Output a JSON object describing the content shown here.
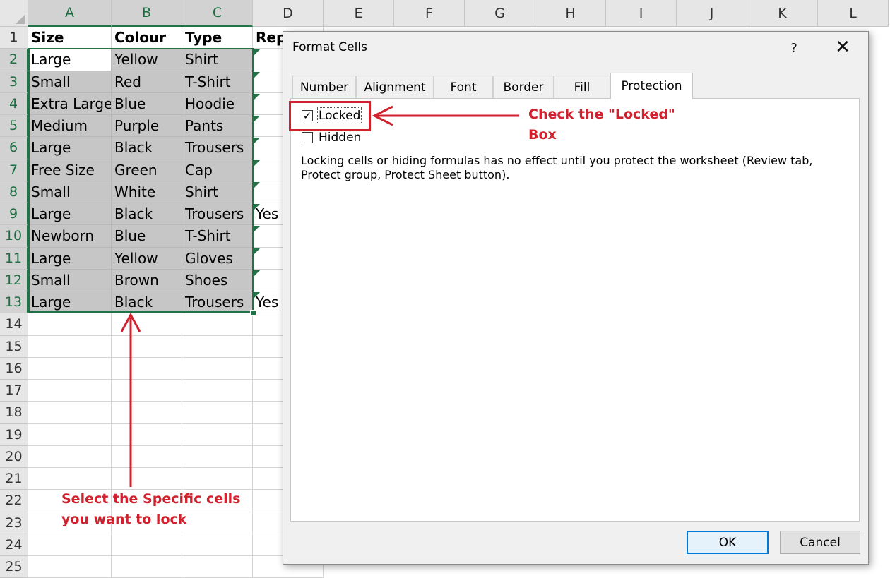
{
  "sheet": {
    "columns": [
      "A",
      "B",
      "C",
      "D",
      "E",
      "F",
      "G",
      "H",
      "I",
      "J",
      "K",
      "L"
    ],
    "row_numbers": [
      "1",
      "2",
      "3",
      "4",
      "5",
      "6",
      "7",
      "8",
      "9",
      "10",
      "11",
      "12",
      "13",
      "14",
      "15",
      "16",
      "17",
      "18",
      "19",
      "20",
      "21",
      "22",
      "23",
      "24",
      "25"
    ],
    "header_row": [
      "Size",
      "Colour",
      "Type",
      "Rep"
    ],
    "rows": [
      [
        "Large",
        "Yellow",
        "Shirt",
        ""
      ],
      [
        "Small",
        "Red",
        "T-Shirt",
        ""
      ],
      [
        "Extra Large",
        "Blue",
        "Hoodie",
        ""
      ],
      [
        "Medium",
        "Purple",
        "Pants",
        ""
      ],
      [
        "Large",
        "Black",
        "Trousers",
        ""
      ],
      [
        "Free Size",
        "Green",
        "Cap",
        ""
      ],
      [
        "Small",
        "White",
        "Shirt",
        ""
      ],
      [
        "Large",
        "Black",
        "Trousers",
        "Yes"
      ],
      [
        "Newborn",
        "Blue",
        "T-Shirt",
        ""
      ],
      [
        "Large",
        "Yellow",
        "Gloves",
        ""
      ],
      [
        "Small",
        "Brown",
        "Shoes",
        ""
      ],
      [
        "Large",
        "Black",
        "Trousers",
        "Yes"
      ]
    ]
  },
  "dialog": {
    "title": "Format Cells",
    "help": "?",
    "close": "✕",
    "tabs": [
      "Number",
      "Alignment",
      "Font",
      "Border",
      "Fill",
      "Protection"
    ],
    "active_tab": "Protection",
    "locked_label": "Locked",
    "locked_checked": true,
    "hidden_label": "Hidden",
    "hidden_checked": false,
    "info_text": "Locking cells or hiding formulas has no effect until you protect the worksheet (Review tab, Protect group, Protect Sheet button).",
    "ok_label": "OK",
    "cancel_label": "Cancel"
  },
  "annotations": {
    "locked_note_line1": "Check the \"Locked\"",
    "locked_note_line2": "Box",
    "select_note_line1": "Select the Specific cells",
    "select_note_line2": "you want to lock",
    "color": "#d0222e"
  },
  "colors": {
    "excel_green": "#217346",
    "selection_gray": "#c6c6c6",
    "dialog_bg": "#f0f0f0",
    "default_button": "#0078d7"
  }
}
